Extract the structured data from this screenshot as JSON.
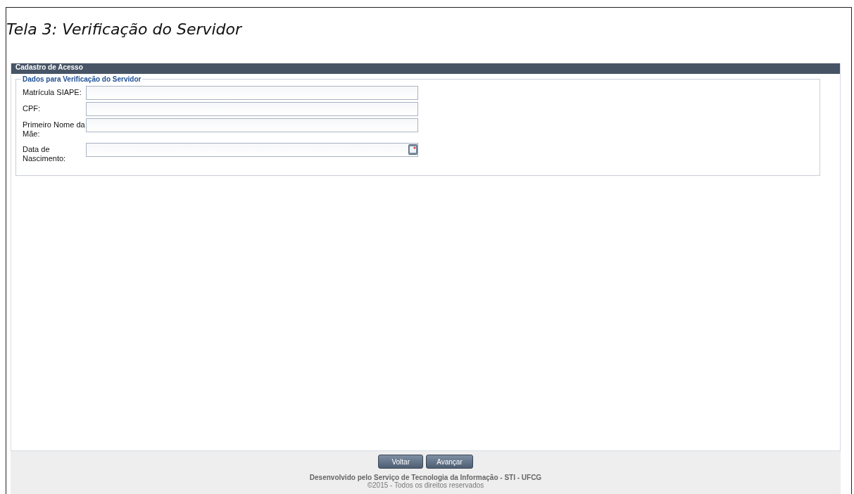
{
  "caption": "Tela 3: Verificação do Servidor",
  "panel": {
    "title": "Cadastro de Acesso"
  },
  "fieldset": {
    "legend": "Dados para Verificação do Servidor",
    "fields": [
      {
        "label": "Matrícula SIAPE:",
        "kind": "text"
      },
      {
        "label": "CPF:",
        "kind": "text"
      },
      {
        "label": "Primeiro Nome da Mãe:",
        "kind": "text"
      },
      {
        "label": "Data de Nascimento:",
        "kind": "date"
      }
    ]
  },
  "buttons": [
    "Voltar",
    "Avançar"
  ],
  "footer": {
    "credit": "Desenvolvido pelo Serviço de Tecnologia da Informação - STI - UFCG",
    "copyright": "©2015 - Todos os direitos reservados"
  }
}
